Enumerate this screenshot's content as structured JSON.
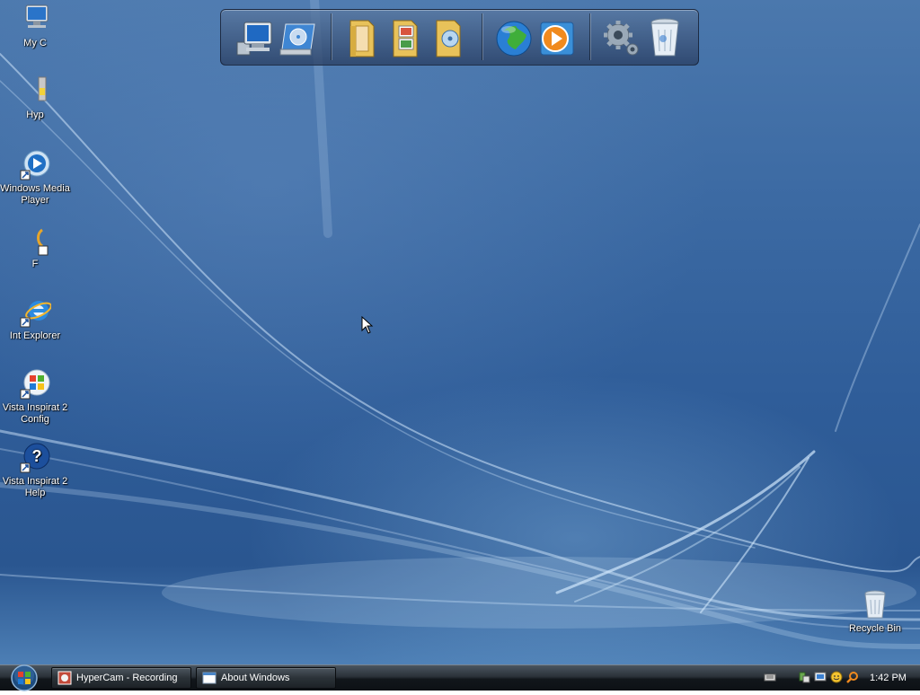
{
  "desktop_icons": [
    {
      "name": "my-computer",
      "label": "My C"
    },
    {
      "name": "hypercam",
      "label": "Hyp"
    },
    {
      "name": "windows-media-player",
      "label": "Windows Media Player"
    },
    {
      "name": "unknown-app",
      "label": "F"
    },
    {
      "name": "internet-explorer",
      "label": "Int Explorer"
    },
    {
      "name": "vista-inspirat-config",
      "label": "Vista Inspirat 2 Config"
    },
    {
      "name": "vista-inspirat-help",
      "label": "Vista Inspirat 2 Help"
    },
    {
      "name": "recycle-bin",
      "label": "Recycle Bin"
    }
  ],
  "dock": {
    "items": [
      "computer-icon",
      "disk-drive-icon",
      "documents-folder-icon",
      "pictures-folder-icon",
      "music-folder-icon",
      "internet-globe-icon",
      "media-player-icon",
      "settings-gears-icon",
      "recycle-bin-icon"
    ]
  },
  "taskbar": {
    "tasks": [
      {
        "label": "HyperCam - Recording"
      },
      {
        "label": "About Windows"
      }
    ],
    "clock": "1:42 PM"
  },
  "colors": {
    "desktop": "#2f5d99",
    "taskbar": "#1a1f24"
  }
}
